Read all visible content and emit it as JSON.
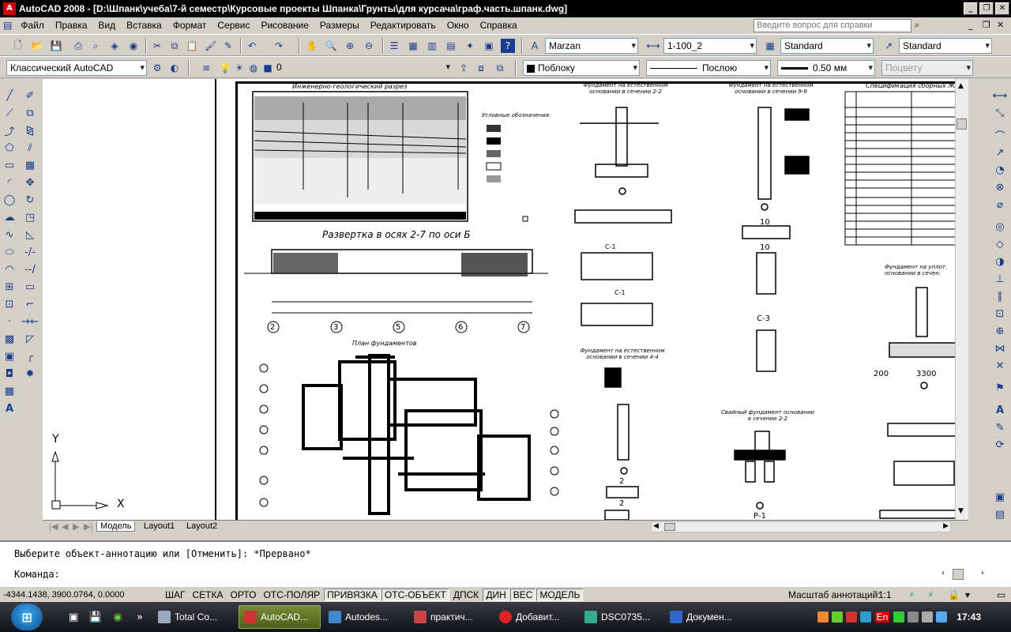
{
  "window": {
    "title": "AutoCAD 2008 - [D:\\Шпанк\\учеба\\7-й семестр\\Курсовые проекты Шпанка\\Грунты\\для курсача\\граф.часть.шпанк.dwg]"
  },
  "menu": {
    "items": [
      "Файл",
      "Правка",
      "Вид",
      "Вставка",
      "Формат",
      "Сервис",
      "Рисование",
      "Размеры",
      "Редактировать",
      "Окно",
      "Справка"
    ],
    "help_placeholder": "Введите вопрос для справки"
  },
  "toolbar1": {
    "text_style": "Marzan",
    "dim_style": "1-100_2",
    "table_style": "Standard",
    "mleader_style": "Standard"
  },
  "toolbar2": {
    "workspace": "Классический AutoCAD",
    "layer": "0",
    "color": "Поблоку",
    "linetype": "Послою",
    "lineweight": "0.50 мм",
    "plotstyle": "Поцвету"
  },
  "drawing": {
    "labels": {
      "geo_section": "Инженерно-геологический разрез",
      "legend_title": "Условные обозначения:",
      "razvertka": "Развертка в осях 2-7 по оси Б",
      "plan": "План фундаментов",
      "fund_2_2": "Фундамент на естественном основании в сечении 2-2",
      "fund_9_9": "Фундамент на естественном основании в сечении 9-9",
      "fund_4_4": "Фундамент на естественном основании в сечении 4-4",
      "svai": "Свайный фундамент основании в сечении 2-2",
      "spec": "Спецификация сборных Ж/Б",
      "fund_upl": "Фундамент на уплот. основании в сечен.",
      "c1": "С-1",
      "c3": "С-3",
      "p1": "Р-1",
      "n10a": "10",
      "n10b": "10",
      "n2a": "2",
      "n2b": "2",
      "n200": "200",
      "n3300": "3300"
    },
    "axes": [
      "2",
      "3",
      "5",
      "6",
      "7"
    ],
    "ucs": {
      "x": "X",
      "y": "Y"
    }
  },
  "tabs": [
    "Модель",
    "Layout1",
    "Layout2"
  ],
  "command": {
    "line1": "Выберите объект-аннотацию или [Отменить]: *Прервано*",
    "line2": "Команда:"
  },
  "status": {
    "coords": "-4344.1438, 3900.0764, 0.0000",
    "buttons": [
      {
        "label": "ШАГ",
        "on": false
      },
      {
        "label": "СЕТКА",
        "on": false
      },
      {
        "label": "ОРТО",
        "on": false
      },
      {
        "label": "ОТС-ПОЛЯР",
        "on": false
      },
      {
        "label": "ПРИВЯЗКА",
        "on": true
      },
      {
        "label": "ОТС-ОБЪЕКТ",
        "on": true
      },
      {
        "label": "ДПСК",
        "on": false
      },
      {
        "label": "ДИН",
        "on": true
      },
      {
        "label": "ВЕС",
        "on": true
      },
      {
        "label": "МОДЕЛЬ",
        "on": true
      }
    ],
    "annot_scale_label": "Масштаб аннотаций:",
    "annot_scale_value": "1:1"
  },
  "taskbar": {
    "tasks": [
      {
        "label": "Total Co...",
        "active": false
      },
      {
        "label": "AutoCAD...",
        "active": true
      },
      {
        "label": "Autodes...",
        "active": false
      },
      {
        "label": "практич...",
        "active": false
      },
      {
        "label": "Добавит...",
        "active": false
      },
      {
        "label": "DSC0735...",
        "active": false
      },
      {
        "label": "Докумен...",
        "active": false
      }
    ],
    "lang": "En",
    "clock": "17:43"
  },
  "colors": {
    "title_bg": "#000000",
    "active_task": "#6b7a2a",
    "accent": "#1a3c8c"
  }
}
